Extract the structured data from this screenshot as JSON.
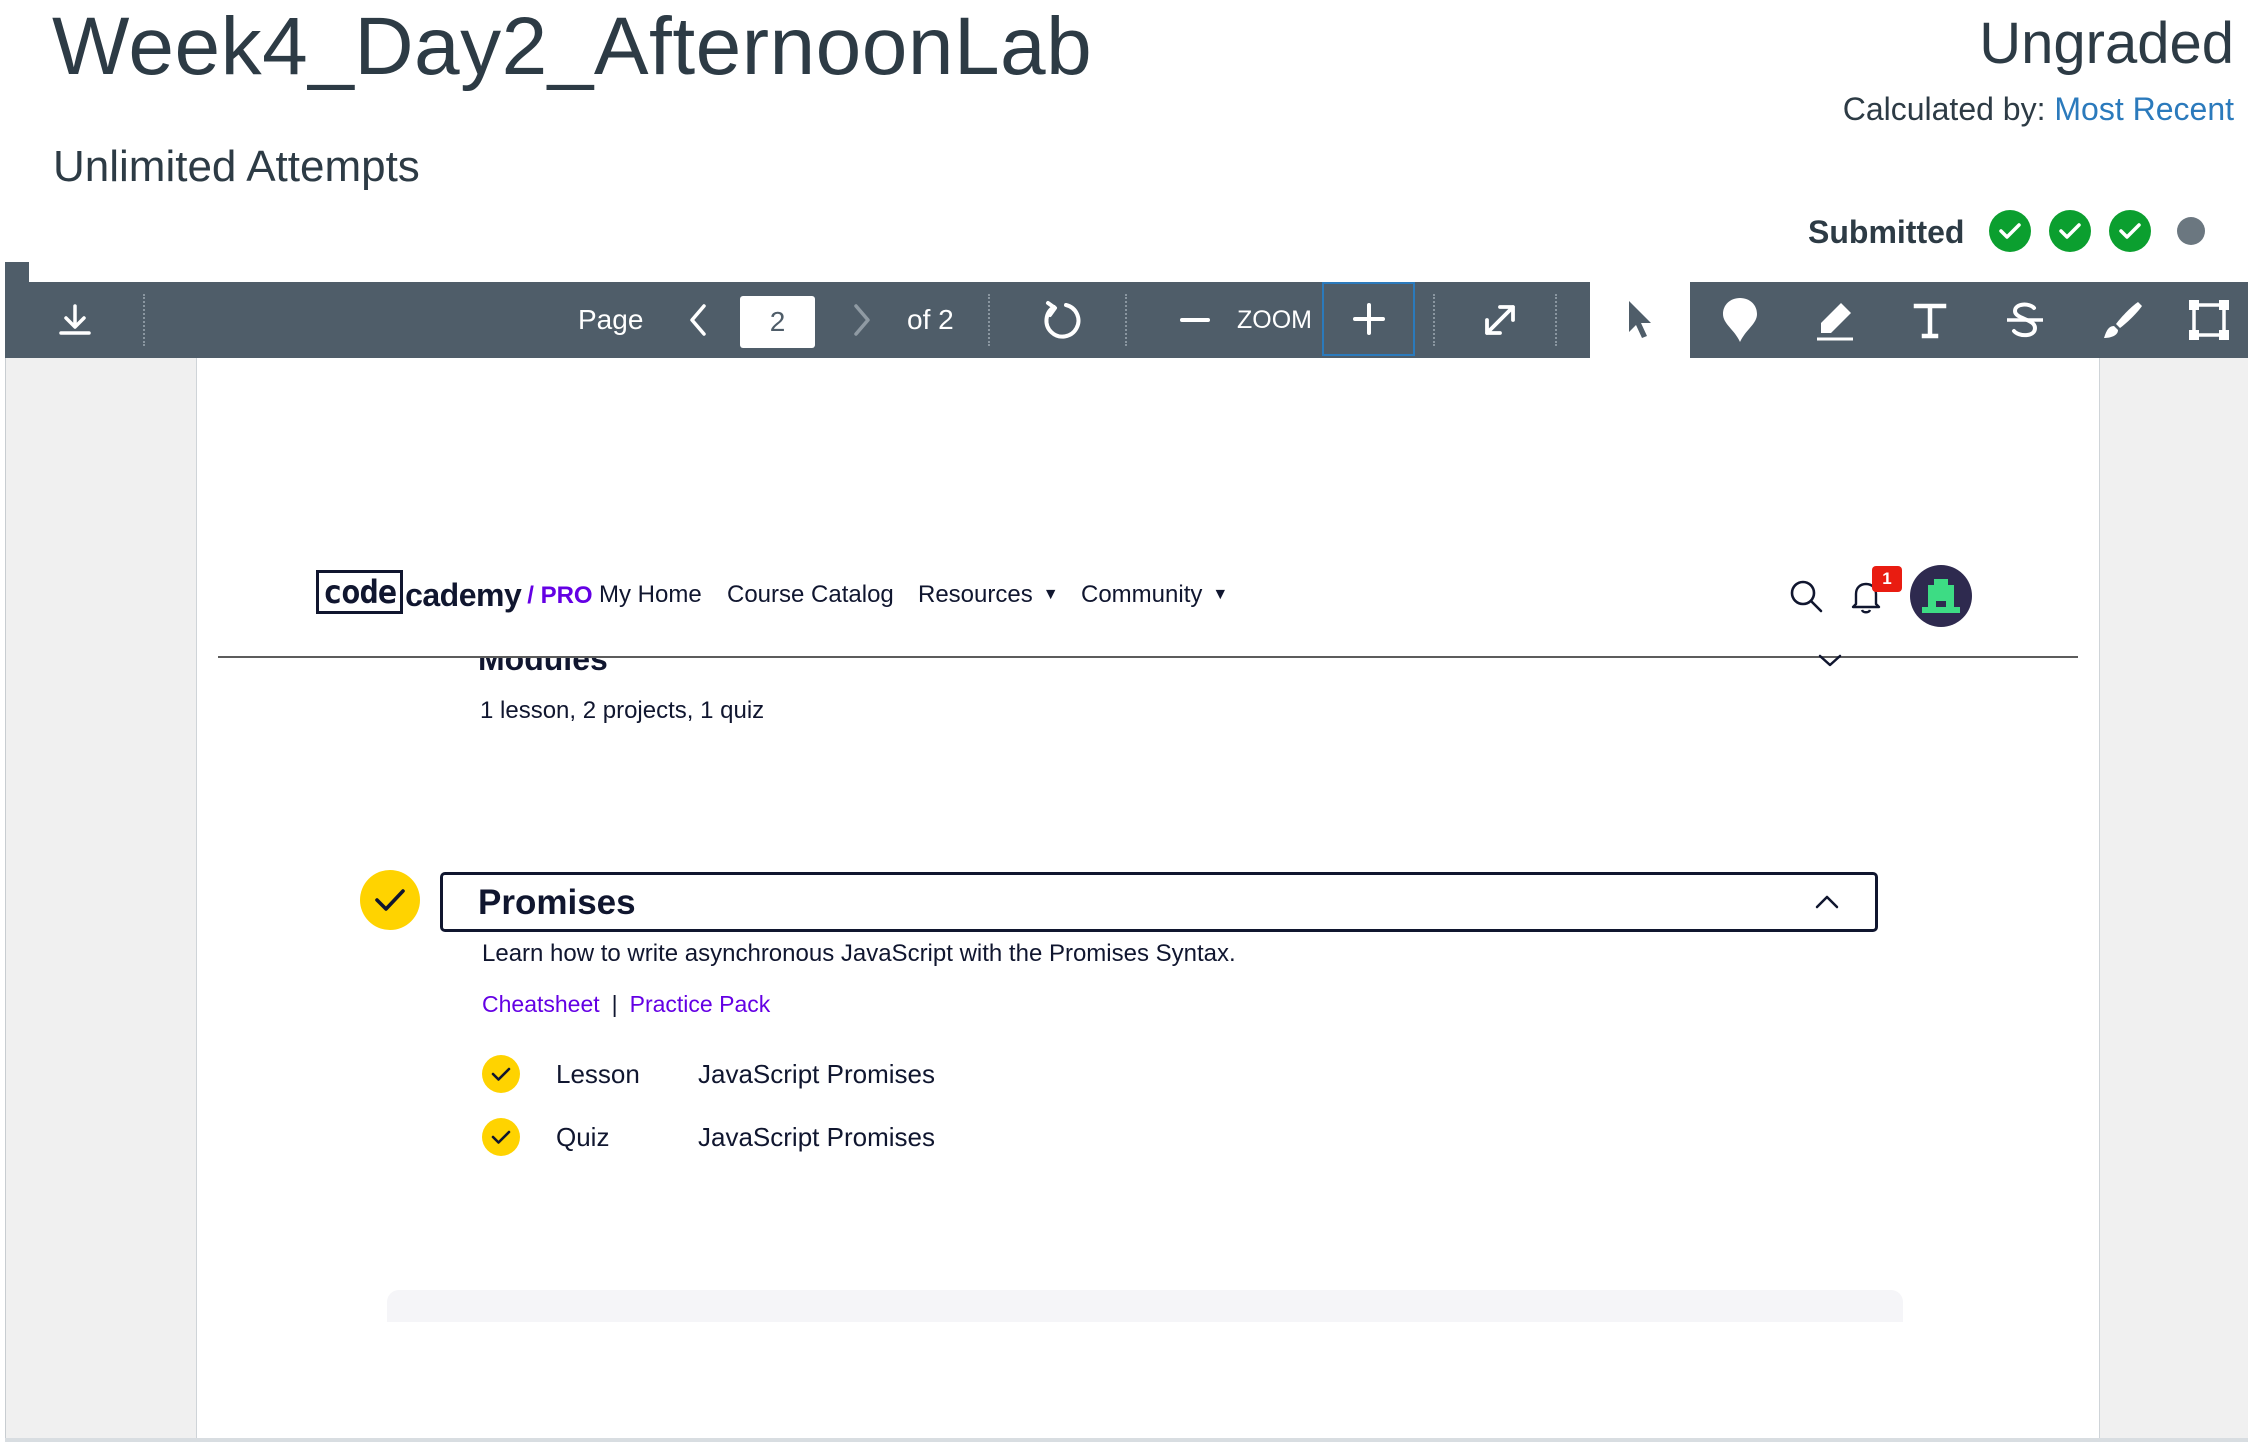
{
  "assignment": {
    "title": "Week4_Day2_AfternoonLab",
    "attempts": "Unlimited Attempts",
    "grade": "Ungraded",
    "calculated_by_label": "Calculated by:",
    "calculated_by_value": "Most Recent",
    "submitted_label": "Submitted",
    "submission_dots": [
      "complete",
      "complete",
      "complete",
      "pending"
    ]
  },
  "toolbar": {
    "page_label": "Page",
    "current_page": "2",
    "of_label": "of 2",
    "zoom_label": "ZOOM",
    "icons": [
      "download-icon",
      "chevron-left-icon",
      "chevron-right-icon",
      "rotate-icon",
      "zoom-out-icon",
      "zoom-in-icon",
      "fullscreen-icon",
      "pointer-icon",
      "pin-icon",
      "highlight-icon",
      "text-icon",
      "strikethrough-icon",
      "draw-icon",
      "area-icon"
    ]
  },
  "codecademy": {
    "logo_code": "code",
    "logo_cademy": "cademy",
    "logo_pro": "/ PRO",
    "nav": {
      "my_home": "My Home",
      "course_catalog": "Course Catalog",
      "resources": "Resources",
      "community": "Community"
    },
    "notification_count": "1",
    "modules_heading": "Modules",
    "modules_summary": "1 lesson, 2 projects, 1 quiz",
    "section": {
      "title": "Promises",
      "description": "Learn how to write asynchronous JavaScript with the Promises Syntax.",
      "link_cheatsheet": "Cheatsheet",
      "link_separator": "|",
      "link_practice": "Practice Pack",
      "items": [
        {
          "type": "Lesson",
          "name": "JavaScript Promises",
          "completed": true
        },
        {
          "type": "Quiz",
          "name": "JavaScript Promises",
          "completed": true
        }
      ]
    }
  },
  "colors": {
    "canvas_text": "#2d3b45",
    "canvas_link": "#2b7abc",
    "success_green": "#0b9f2f",
    "pending_gray": "#6b7780",
    "toolbar_bg": "#4f5d69",
    "cc_navy": "#10162f",
    "cc_purple": "#6400e4",
    "cc_yellow": "#ffd300",
    "cc_badge_red": "#e91c11"
  }
}
